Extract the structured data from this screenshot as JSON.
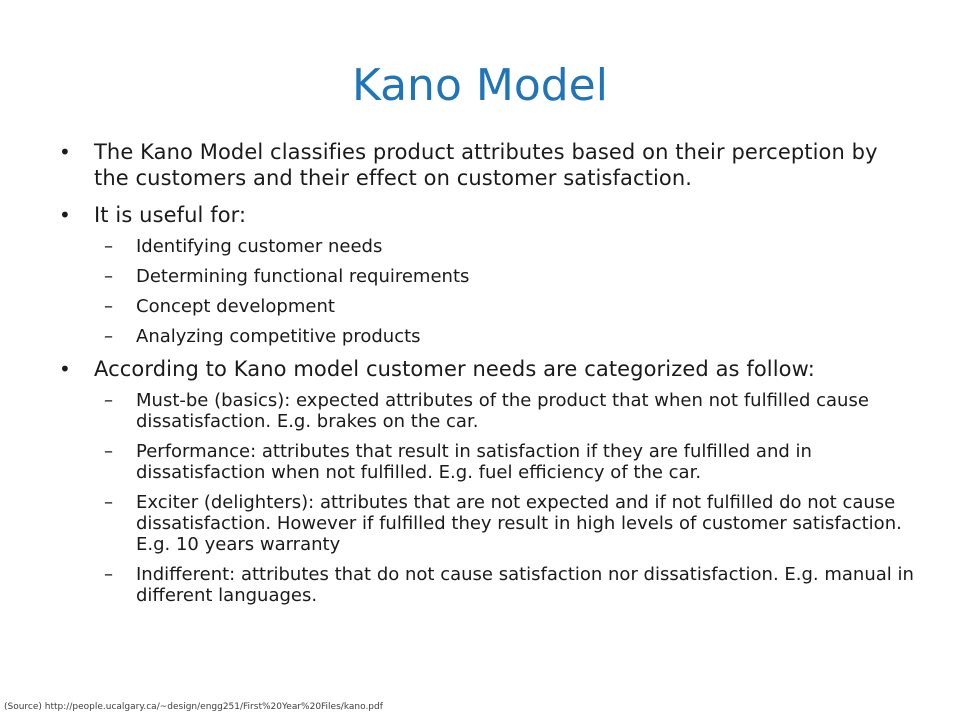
{
  "slide": {
    "title": "Kano Model",
    "title_color": "#1f75b8",
    "bullets": [
      {
        "marker": "•",
        "text": "The Kano Model classifies product attributes based on their perception by the customers and their effect on customer satisfaction."
      },
      {
        "marker": "•",
        "text": "It is useful for:"
      },
      {
        "marker": "•",
        "text": "According to Kano model customer needs are categorized as follow:"
      }
    ],
    "useful_for": [
      {
        "marker": "–",
        "text": "Identifying customer needs"
      },
      {
        "marker": "–",
        "text": "Determining functional requirements"
      },
      {
        "marker": "–",
        "text": "Concept development"
      },
      {
        "marker": "–",
        "text": "Analyzing competitive products"
      }
    ],
    "categories": [
      {
        "marker": "–",
        "text": "Must-be (basics): expected attributes of the product that when not fulfilled cause dissatisfaction. E.g. brakes on the car."
      },
      {
        "marker": "–",
        "text": "Performance: attributes that result in satisfaction if they are fulfilled and in dissatisfaction when not fulfilled. E.g. fuel efficiency of the car."
      },
      {
        "marker": "–",
        "text": "Exciter (delighters): attributes that are not expected and if not fulfilled do not cause dissatisfaction. However if fulfilled they result in high levels of customer satisfaction. E.g. 10 years warranty"
      },
      {
        "marker": "–",
        "text": "Indifferent: attributes that do not cause satisfaction nor dissatisfaction. E.g. manual in different languages."
      }
    ],
    "source": "(Source) http://people.ucalgary.ca/~design/engg251/First%20Year%20Files/kano.pdf"
  }
}
